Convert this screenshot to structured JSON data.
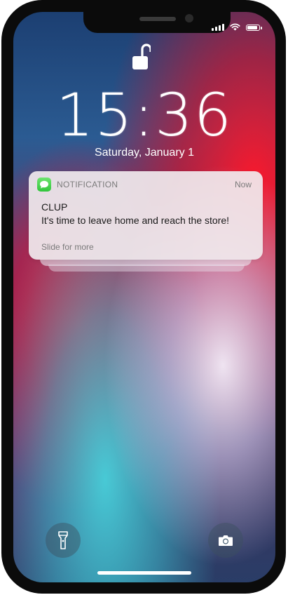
{
  "lockscreen": {
    "time": "15:36",
    "date": "Saturday, January 1"
  },
  "status_bar": {
    "signal_icon": "signal-bars-icon",
    "wifi_icon": "wifi-icon",
    "battery_icon": "battery-icon",
    "battery_level": 0.9
  },
  "notification": {
    "app_icon": "messages-icon",
    "app_name": "NOTIFICATION",
    "time": "Now",
    "title": "CLUP",
    "body": "It's time to leave home and reach the store!",
    "footer": "Slide for more"
  },
  "quick_actions": {
    "left_icon": "flashlight-icon",
    "right_icon": "camera-icon"
  },
  "colors": {
    "notification_icon_green": "#34c759",
    "phone_frame": "#0b0b0b"
  }
}
